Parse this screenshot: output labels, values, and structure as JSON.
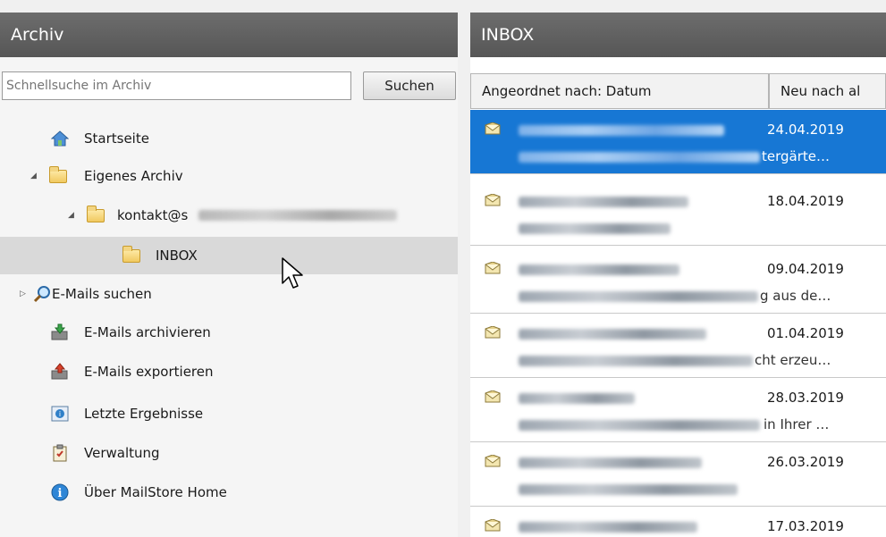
{
  "left_header": {
    "title": "Archiv"
  },
  "right_header": {
    "title": "INBOX"
  },
  "search": {
    "placeholder": "Schnellsuche im Archiv",
    "button_label": "Suchen"
  },
  "tree": {
    "home": "Startseite",
    "own_archive": "Eigenes Archiv",
    "account": "kontakt@s",
    "inbox": "INBOX",
    "search_mails": "E-Mails suchen",
    "archive_mails": "E-Mails archivieren",
    "export_mails": "E-Mails exportieren",
    "recent_results": "Letzte Ergebnisse",
    "administration": "Verwaltung",
    "about": "Über MailStore Home"
  },
  "list_header": {
    "sorted_by": "Angeordnet nach: Datum",
    "newest": "Neu nach al"
  },
  "mails": [
    {
      "date": "24.04.2019",
      "snippet_tail": "tergärte…"
    },
    {
      "date": "18.04.2019",
      "snippet_tail": ""
    },
    {
      "date": "09.04.2019",
      "snippet_tail": "g aus de…"
    },
    {
      "date": "01.04.2019",
      "snippet_tail": "cht erzeu…"
    },
    {
      "date": "28.03.2019",
      "snippet_tail": "in Ihrer …"
    },
    {
      "date": "26.03.2019",
      "snippet_tail": ""
    },
    {
      "date": "17.03.2019",
      "snippet_tail": ""
    }
  ],
  "colors": {
    "header_bg": "#5f5f5f",
    "selection_blue": "#1777d4",
    "tree_selection": "#d9d9d9"
  }
}
